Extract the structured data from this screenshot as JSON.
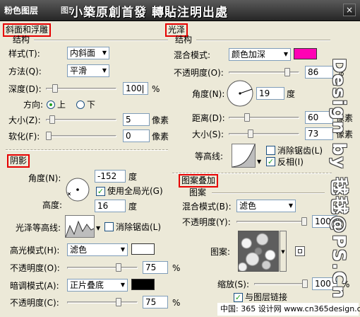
{
  "window": {
    "title": "粉色图层",
    "title_icon": "图5",
    "watermark": "小築原創首發  轉貼注明出處",
    "close": "×"
  },
  "bevel": {
    "section": "斜面和浮雕",
    "group": "结构",
    "style_label": "样式(T):",
    "style_value": "内斜面",
    "method_label": "方法(Q):",
    "method_value": "平滑",
    "depth_label": "深度(D):",
    "depth_value": "100",
    "depth_unit": "%",
    "depth_level": 0.1,
    "direction_label": "方向:",
    "dir_up": "上",
    "dir_down": "下",
    "size_label": "大小(Z):",
    "size_value": "5",
    "size_unit": "像素",
    "soften_label": "软化(F):",
    "soften_value": "0",
    "soften_unit": "像素"
  },
  "shading": {
    "section": "阴影",
    "angle_label": "角度(N):",
    "angle_value": "-152",
    "angle_unit": "度",
    "global_light": "使用全局光(G)",
    "altitude_label": "高度:",
    "altitude_value": "16",
    "altitude_unit": "度",
    "gloss_label": "光泽等高线:",
    "antialias": "消除锯齿(L)",
    "highlight_label": "高光模式(H):",
    "highlight_mode": "滤色",
    "highlight_color": "#ffffff",
    "highlight_opacity_label": "不透明度(O):",
    "highlight_opacity": "75",
    "shadow_label": "暗调模式(A):",
    "shadow_mode": "正片叠底",
    "shadow_color": "#000000",
    "shadow_opacity_label": "不透明度(C):",
    "shadow_opacity": "75",
    "percent": "%"
  },
  "satin": {
    "section": "光泽",
    "group": "结构",
    "blend_label": "混合模式:",
    "blend_value": "颜色加深",
    "color": "#ff00b4",
    "opacity_label": "不透明度(O):",
    "opacity_value": "86",
    "angle_label": "角度(N):",
    "angle_value": "19",
    "angle_unit": "度",
    "distance_label": "距离(D):",
    "distance_value": "60",
    "size_label": "大小(S):",
    "size_value": "73",
    "unit": "像素",
    "contour_label": "等高线:",
    "antialias": "消除锯齿(L)",
    "invert": "反相(I)",
    "percent": "%"
  },
  "pattern": {
    "section": "图案叠加",
    "group": "图案",
    "blend_label": "混合模式(B):",
    "blend_value": "滤色",
    "opacity_label": "不透明度(Y):",
    "opacity_value": "100",
    "pattern_label": "图案:",
    "scale_label": "缩放(S):",
    "scale_value": "100",
    "link_label": "与图层链接",
    "percent": "%"
  },
  "side_watermark": "Design by 毬毬@PS.Cn",
  "bottom_watermark": "中国: 365 设计网  www.cn365design.com",
  "slider_levels": {
    "depth": 0.1,
    "size": 0.05,
    "soften": 0.0,
    "highlight_opacity": 0.75,
    "shadow_opacity": 0.75,
    "satin_opacity": 0.86,
    "satin_distance": 0.24,
    "satin_size": 0.29,
    "pattern_opacity": 1.0,
    "scale": 1.0
  }
}
